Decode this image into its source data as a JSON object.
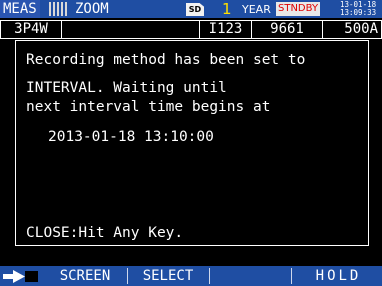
{
  "status_bar": {
    "mode": "MEAS",
    "zoom": "ZOOM",
    "sd_label": "SD",
    "record_count": "1",
    "year_label": "YEAR",
    "state": "STNDBY",
    "date": "13-01-18",
    "time": "13:09:33",
    "colors": {
      "bar": "#1f4ea3",
      "count": "#ffe000",
      "state_text": "#e00000"
    }
  },
  "setting_row": {
    "wiring": "3P4W",
    "current_input": "I123",
    "vt_ratio": "9661",
    "ct_range": "500A"
  },
  "dialog": {
    "line1": "Recording method has been set to",
    "line2": "INTERVAL. Waiting until",
    "line3": "next interval time begins at",
    "start_time": "2013-01-18 13:10:00",
    "close_hint": "CLOSE:Hit Any Key."
  },
  "function_bar": {
    "icon": "enter-key-icon",
    "keys": [
      "SCREEN",
      "SELECT",
      "",
      "HOLD"
    ]
  }
}
